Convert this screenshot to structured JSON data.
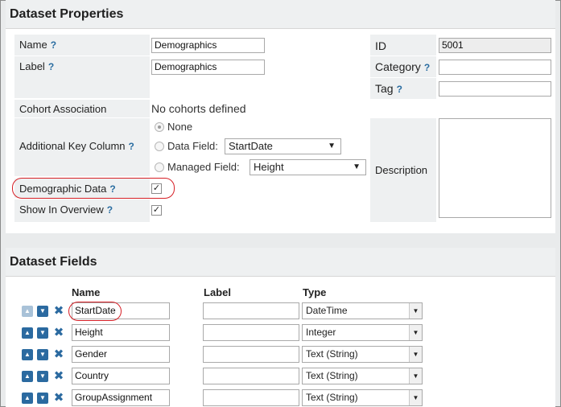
{
  "properties": {
    "title": "Dataset Properties",
    "help_mark": "?",
    "name": {
      "label": "Name",
      "value": "Demographics"
    },
    "label": {
      "label": "Label",
      "value": "Demographics"
    },
    "cohort": {
      "label": "Cohort Association",
      "value": "No cohorts defined"
    },
    "additional_key": {
      "label": "Additional Key Column",
      "options": {
        "none": "None",
        "data_field": "Data Field:",
        "managed_field": "Managed Field:"
      },
      "data_field_value": "StartDate",
      "managed_field_value": "Height",
      "selected": "None"
    },
    "demographic": {
      "label": "Demographic Data",
      "checked": "✓"
    },
    "show_overview": {
      "label": "Show In Overview",
      "checked": "✓"
    },
    "id": {
      "label": "ID",
      "value": "5001"
    },
    "category": {
      "label": "Category",
      "value": ""
    },
    "tag": {
      "label": "Tag",
      "value": ""
    },
    "description": {
      "label": "Description",
      "value": ""
    }
  },
  "fields": {
    "title": "Dataset Fields",
    "columns": {
      "name": "Name",
      "label": "Label",
      "type": "Type"
    },
    "rows": [
      {
        "name": "StartDate",
        "label": "",
        "type": "DateTime"
      },
      {
        "name": "Height",
        "label": "",
        "type": "Integer"
      },
      {
        "name": "Gender",
        "label": "",
        "type": "Text (String)"
      },
      {
        "name": "Country",
        "label": "",
        "type": "Text (String)"
      },
      {
        "name": "GroupAssignment",
        "label": "",
        "type": "Text (String)"
      }
    ]
  },
  "colors": {
    "accent": "#2b6aa0",
    "highlight": "#d61f26",
    "label_bg": "#eef0f1"
  }
}
